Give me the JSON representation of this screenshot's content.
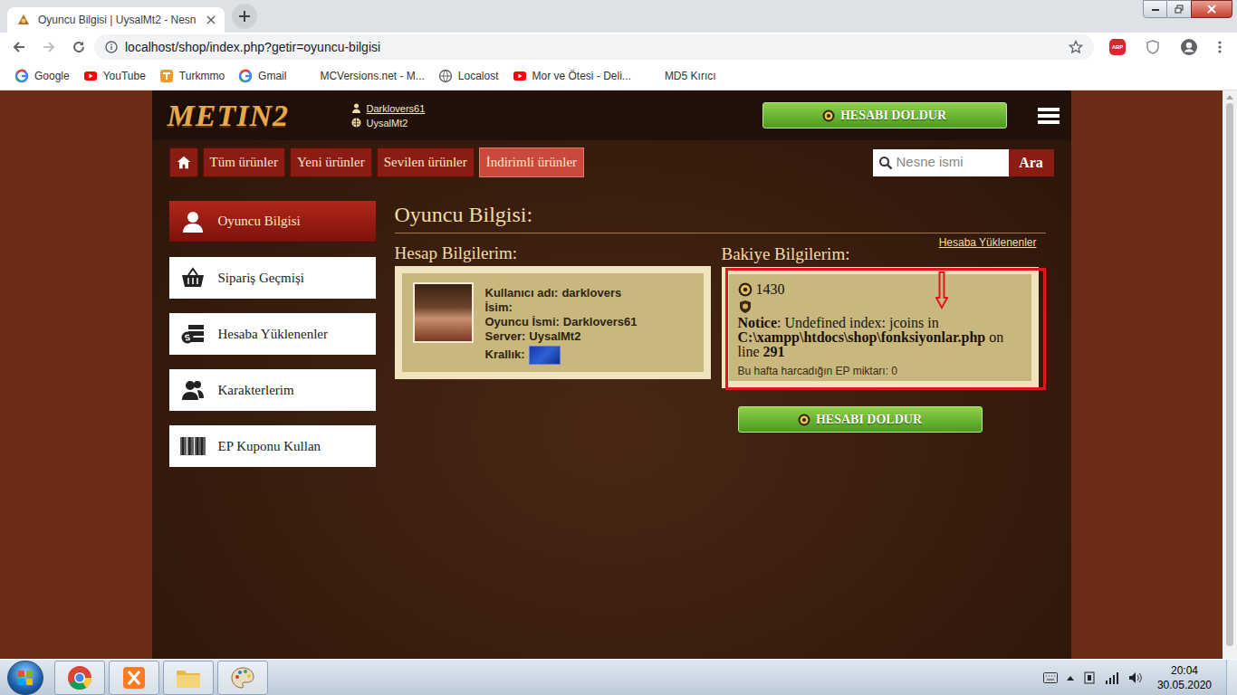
{
  "browser": {
    "tabs": [
      {
        "label": "Oyuncu Bilgisi | UysalMt2 - Nesn",
        "selected": true
      }
    ],
    "url": "localhost/shop/index.php?getir=oyuncu-bilgisi",
    "extension_badge": "ABP",
    "bookmarks": [
      {
        "label": "Google",
        "kind": "google"
      },
      {
        "label": "YouTube",
        "kind": "youtube"
      },
      {
        "label": "Turkmmo",
        "kind": "turkmmo"
      },
      {
        "label": "Gmail",
        "kind": "google"
      },
      {
        "label": "MCVersions.net - M...",
        "kind": "blank"
      },
      {
        "label": "Localost",
        "kind": "globe"
      },
      {
        "label": "Mor ve Ötesi - Deli...",
        "kind": "youtube"
      },
      {
        "label": "MD5 Kırıcı",
        "kind": "blank"
      }
    ]
  },
  "header": {
    "logo": "METIN2",
    "user": "Darklovers61",
    "server": "UysalMt2",
    "fill_button": "HESABI DOLDUR"
  },
  "nav": {
    "items": [
      {
        "label": "Tüm ürünler",
        "selected": false
      },
      {
        "label": "Yeni ürünler",
        "selected": false
      },
      {
        "label": "Sevilen ürünler",
        "selected": false
      },
      {
        "label": "İndirimli ürünler",
        "selected": true
      }
    ],
    "search_placeholder": "Nesne ismi",
    "search_button": "Ara"
  },
  "sidebar": {
    "items": [
      {
        "label": "Oyuncu Bilgisi",
        "selected": true,
        "kind": "user"
      },
      {
        "label": "Sipariş Geçmişi",
        "selected": false,
        "kind": "basket"
      },
      {
        "label": "Hesaba Yüklenenler",
        "selected": false,
        "kind": "money"
      },
      {
        "label": "Karakterlerim",
        "selected": false,
        "kind": "users"
      },
      {
        "label": "EP Kuponu Kullan",
        "selected": false,
        "kind": "barcode"
      }
    ]
  },
  "page": {
    "title": "Oyuncu Bilgisi:"
  },
  "account": {
    "heading": "Hesap Bilgilerim:",
    "fields": [
      {
        "label": "Kullanıcı adı:",
        "value": "darklovers"
      },
      {
        "label": "İsim:"
      },
      {
        "label": "Oyuncu İsmi:",
        "value": "Darklovers61"
      },
      {
        "label": "Server:",
        "value": "UysalMt2"
      },
      {
        "label": "Krallık:",
        "kind": "flag"
      }
    ]
  },
  "balance": {
    "heading": "Bakiye Bilgilerim:",
    "link": "Hesaba Yüklenenler",
    "coins": "1430",
    "notice": {
      "label": "Notice",
      "message": ": Undefined index: jcoins in ",
      "path": "C:\\xampp\\htdocs\\shop\\fonksiyonlar.php",
      "line_prefix": " on line ",
      "line": "291"
    },
    "weekly": "Bu hafta harcadığın EP miktarı: 0",
    "button": "HESABI DOLDUR"
  },
  "taskbar": {
    "time": "20:04",
    "date": "30.05.2020"
  }
}
